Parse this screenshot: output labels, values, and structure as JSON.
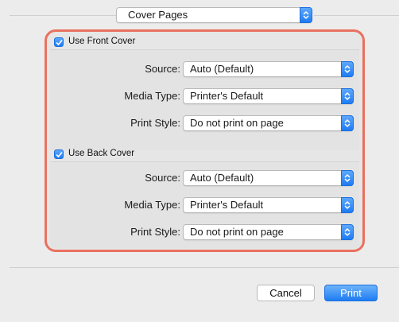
{
  "section_popup": {
    "value": "Cover Pages"
  },
  "front": {
    "checkbox_label": "Use Front Cover",
    "checked": true,
    "rows": [
      {
        "label": "Source:",
        "value": "Auto (Default)"
      },
      {
        "label": "Media Type:",
        "value": "Printer's Default"
      },
      {
        "label": "Print Style:",
        "value": "Do not print on page"
      }
    ]
  },
  "back": {
    "checkbox_label": "Use Back Cover",
    "checked": true,
    "rows": [
      {
        "label": "Source:",
        "value": "Auto (Default)"
      },
      {
        "label": "Media Type:",
        "value": "Printer's Default"
      },
      {
        "label": "Print Style:",
        "value": "Do not print on page"
      }
    ]
  },
  "footer": {
    "cancel_label": "Cancel",
    "print_label": "Print"
  },
  "colors": {
    "accent": "#1f7cf2",
    "highlight": "#e9715f"
  }
}
